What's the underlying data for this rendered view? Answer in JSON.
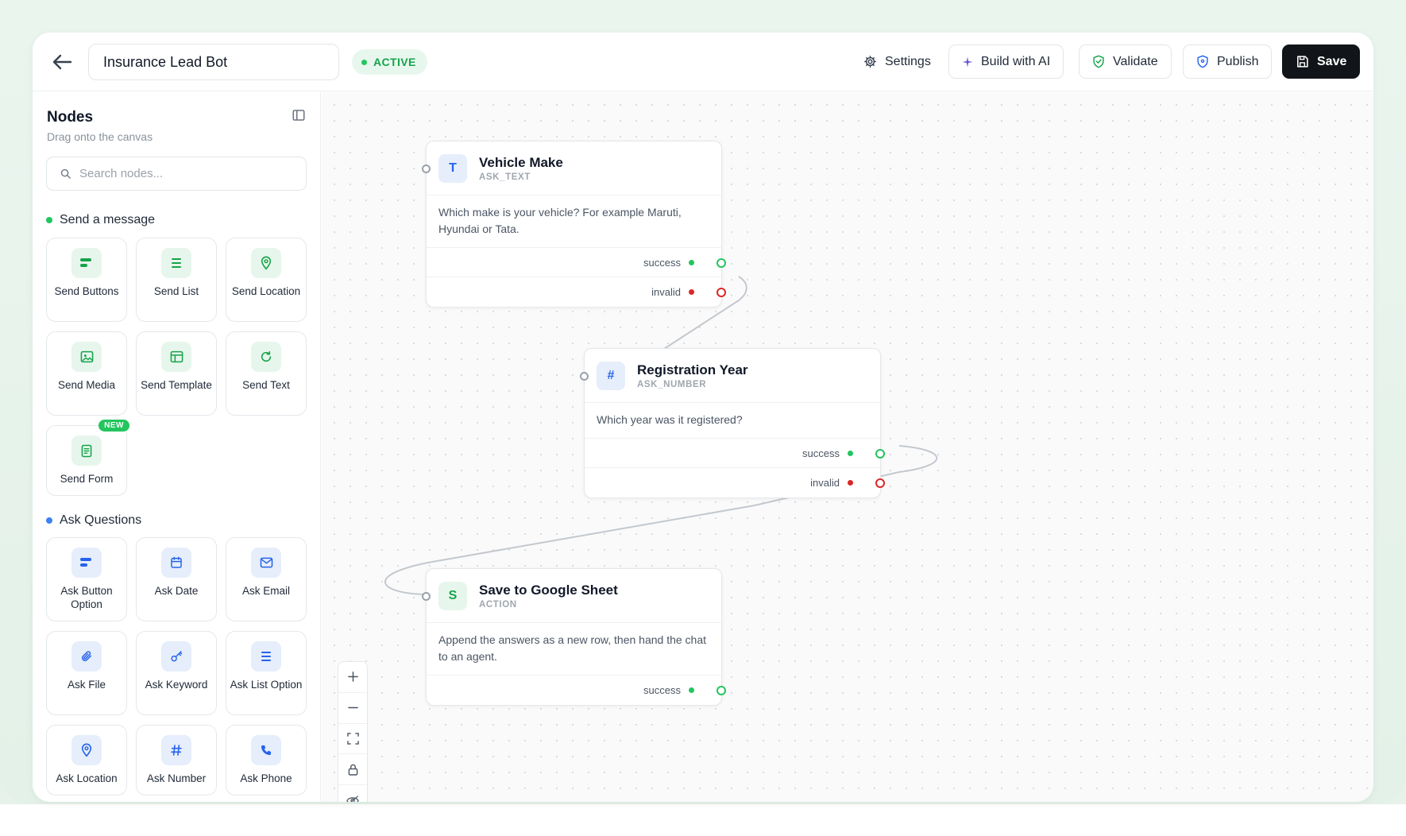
{
  "header": {
    "bot_name": "Insurance Lead Bot",
    "status": "ACTIVE",
    "back_icon": "arrow-left-icon",
    "buttons": {
      "settings": "Settings",
      "build_ai": "Build with AI",
      "validate": "Validate",
      "publish": "Publish",
      "save": "Save"
    }
  },
  "sidebar": {
    "title": "Nodes",
    "subtitle": "Drag onto the canvas",
    "search_placeholder": "Search nodes...",
    "sections": [
      {
        "title": "Send a message",
        "color": "#22c55e",
        "items": [
          {
            "label": "Send Buttons",
            "icon": "buttons-icon"
          },
          {
            "label": "Send List",
            "icon": "list-icon"
          },
          {
            "label": "Send Location",
            "icon": "location-pin-icon"
          },
          {
            "label": "Send Media",
            "icon": "image-icon"
          },
          {
            "label": "Send Template",
            "icon": "template-icon"
          },
          {
            "label": "Send Text",
            "icon": "refresh-icon"
          },
          {
            "label": "Send Form",
            "icon": "form-icon",
            "badge": "NEW"
          }
        ]
      },
      {
        "title": "Ask Questions",
        "color": "#3b82f6",
        "items": [
          {
            "label": "Ask Button Option",
            "icon": "buttons-icon"
          },
          {
            "label": "Ask Date",
            "icon": "calendar-icon"
          },
          {
            "label": "Ask Email",
            "icon": "mail-icon"
          },
          {
            "label": "Ask File",
            "icon": "paperclip-icon"
          },
          {
            "label": "Ask Keyword",
            "icon": "key-icon"
          },
          {
            "label": "Ask List Option",
            "icon": "list-icon"
          },
          {
            "label": "Ask Location",
            "icon": "location-pin-icon"
          },
          {
            "label": "Ask Number",
            "icon": "hash-icon"
          },
          {
            "label": "Ask Phone",
            "icon": "phone-icon"
          }
        ]
      }
    ]
  },
  "canvas": {
    "nodes": [
      {
        "id": "vehicle_make",
        "icon_letter": "T",
        "title": "Vehicle Make",
        "type": "ASK_TEXT",
        "body": "Which make is your vehicle? For example Maruti, Hyundai or Tata.",
        "handles": [
          "success",
          "invalid"
        ]
      },
      {
        "id": "registration_year",
        "icon_letter": "#",
        "title": "Registration Year",
        "type": "ASK_NUMBER",
        "body": "Which year was it registered?",
        "handles": [
          "success",
          "invalid"
        ]
      },
      {
        "id": "save_sheet",
        "icon_letter": "S",
        "title": "Save to Google Sheet",
        "type": "ACTION",
        "body": "Append the answers as a new row, then hand the chat to an agent.",
        "handles": [
          "success"
        ]
      }
    ],
    "controls": [
      "zoom-in-icon",
      "zoom-out-icon",
      "fit-view-icon",
      "lock-icon",
      "hide-icon"
    ]
  },
  "colors": {
    "accent_green": "#22c55e",
    "accent_red": "#dc2626",
    "accent_blue": "#3b82f6",
    "dark_button": "#111418"
  }
}
